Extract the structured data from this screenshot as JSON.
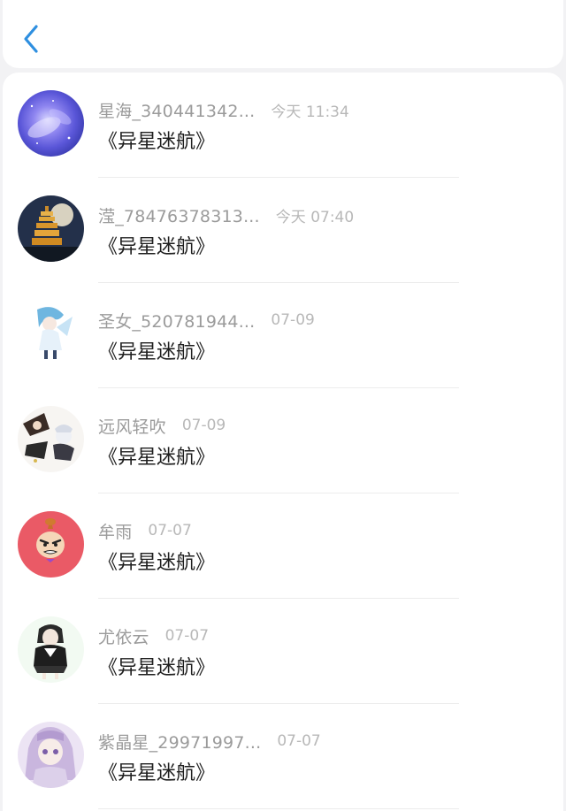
{
  "header": {
    "back_icon": "chevron-left-icon",
    "accent_color": "#2e8fe0"
  },
  "conversations": [
    {
      "name": "星海_340441342...",
      "time": "今天 11:34",
      "title": "《异星迷航》",
      "avatar": "galaxy-avatar"
    },
    {
      "name": "滢_78476378313...",
      "time": "今天 07:40",
      "title": "《异星迷航》",
      "avatar": "pagoda-night-avatar"
    },
    {
      "name": "圣女_520781944...",
      "time": "07-09",
      "title": "《异星迷航》",
      "avatar": "anime-girl-blue-avatar"
    },
    {
      "name": "远风轻吹",
      "time": "07-09",
      "title": "《异星迷航》",
      "avatar": "anime-duo-avatar"
    },
    {
      "name": "牟雨",
      "time": "07-07",
      "title": "《异星迷航》",
      "avatar": "little-my-avatar"
    },
    {
      "name": "尤依云",
      "time": "07-07",
      "title": "《异星迷航》",
      "avatar": "anime-girl-dark-avatar"
    },
    {
      "name": "紫晶星_29971997...",
      "time": "07-07",
      "title": "《异星迷航》",
      "avatar": "anime-girl-purple-avatar"
    }
  ]
}
